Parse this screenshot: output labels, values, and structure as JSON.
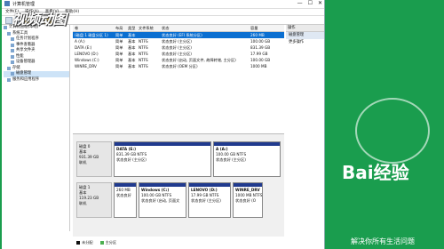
{
  "window": {
    "title": "计算机管理",
    "close_glyph": "✕",
    "min_glyph": "—",
    "max_glyph": "☐"
  },
  "menu": [
    "文件(F)",
    "操作(A)",
    "查看(V)",
    "帮助(H)"
  ],
  "watermark": "视频动图",
  "tree": [
    "计算机管理(本地)",
    "系统工具",
    "任务计划程序",
    "事件查看器",
    "共享文件夹",
    "性能",
    "设备管理器",
    "存储",
    "磁盘管理",
    "服务和应用程序"
  ],
  "table": {
    "headers": [
      "卷",
      "布局",
      "类型",
      "文件系统",
      "状态",
      "容量"
    ],
    "rows": [
      [
        "(磁盘 1 磁盘分区 1)",
        "简单",
        "基本",
        "",
        "状态良好 (EFI 系统分区)",
        "260 MB"
      ],
      [
        "A (A:)",
        "简单",
        "基本",
        "NTFS",
        "状态良好 (主分区)",
        "100.00 GB"
      ],
      [
        "DATA (E:)",
        "简单",
        "基本",
        "NTFS",
        "状态良好 (主分区)",
        "831.39 GB"
      ],
      [
        "LENOVO (D:)",
        "简单",
        "基本",
        "NTFS",
        "状态良好 (主分区)",
        "17.99 GB"
      ],
      [
        "Windows (C:)",
        "简单",
        "基本",
        "NTFS",
        "状态良好 (启动, 页面文件, 故障转储, 主分区)",
        "100.00 GB"
      ],
      [
        "WINRE_DRV",
        "简单",
        "基本",
        "NTFS",
        "状态良好 (OEM 分区)",
        "1000 MB"
      ]
    ]
  },
  "actions": {
    "header": "操作",
    "items": [
      "磁盘管理",
      "更多操作"
    ]
  },
  "disks": [
    {
      "name": "磁盘 0",
      "type": "基本",
      "size": "931.39 GB",
      "status": "联机",
      "parts": [
        {
          "name": "DATA (E:)",
          "size": "831.39 GB NTFS",
          "status": "状态良好 (主分区)"
        },
        {
          "name": "A (A:)",
          "size": "100.00 GB NTFS",
          "status": "状态良好 (主分区)"
        }
      ]
    },
    {
      "name": "磁盘 1",
      "type": "基本",
      "size": "119.23 GB",
      "status": "联机",
      "parts": [
        {
          "name": "",
          "size": "260 MB",
          "status": "状态良好"
        },
        {
          "name": "Windows (C:)",
          "size": "100.00 GB NTFS",
          "status": "状态良好 (启动, 页面文"
        },
        {
          "name": "LENOVO (D:)",
          "size": "17.99 GB NTFS",
          "status": "状态良好 (主分区)"
        },
        {
          "name": "WINRE_DRV",
          "size": "1000 MB NTFS",
          "status": "状态良好 (O"
        }
      ]
    }
  ],
  "legend": [
    "未分配",
    "主分区"
  ],
  "brand": {
    "logo": "Bai经验",
    "slogan": "解决你所有生活问题"
  }
}
